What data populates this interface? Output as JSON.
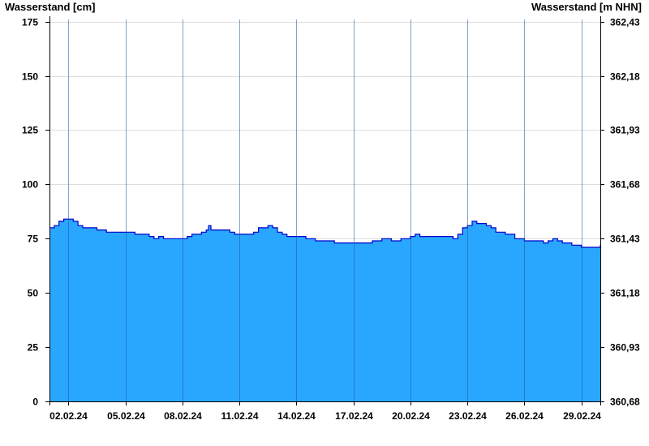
{
  "chart_data": {
    "type": "area",
    "ylabel_left": "Wasserstand [cm]",
    "ylabel_right": "Wasserstand [m NHN]",
    "ylim": [
      0,
      176
    ],
    "left_ticks": [
      0,
      25,
      50,
      75,
      100,
      125,
      150,
      175
    ],
    "right_ticks": [
      "360,68",
      "360,93",
      "361,18",
      "361,43",
      "361,68",
      "361,93",
      "362,18",
      "362,43"
    ],
    "x_start": "2024-02-01",
    "x_end": "2024-03-01",
    "x_tick_labels": [
      "02.02.24",
      "05.02.24",
      "08.02.24",
      "11.02.24",
      "14.02.24",
      "17.02.24",
      "20.02.24",
      "23.02.24",
      "26.02.24",
      "29.02.24"
    ],
    "x_tick_dates": [
      "2024-02-02",
      "2024-02-05",
      "2024-02-08",
      "2024-02-11",
      "2024-02-14",
      "2024-02-17",
      "2024-02-20",
      "2024-02-23",
      "2024-02-26",
      "2024-02-29"
    ],
    "grid": true,
    "colors": {
      "fill": "#29a7ff",
      "line": "#0000cc",
      "grid": "#dddddd",
      "day_lines": "#1a5a9a"
    },
    "series": [
      {
        "name": "",
        "points": [
          [
            "2024-02-01T00:00",
            80
          ],
          [
            "2024-02-01T06:00",
            81
          ],
          [
            "2024-02-01T12:00",
            83
          ],
          [
            "2024-02-01T18:00",
            84
          ],
          [
            "2024-02-02T00:00",
            84
          ],
          [
            "2024-02-02T06:00",
            83
          ],
          [
            "2024-02-02T12:00",
            81
          ],
          [
            "2024-02-02T18:00",
            80
          ],
          [
            "2024-02-03T00:00",
            80
          ],
          [
            "2024-02-03T12:00",
            79
          ],
          [
            "2024-02-04T00:00",
            78
          ],
          [
            "2024-02-04T12:00",
            78
          ],
          [
            "2024-02-05T00:00",
            78
          ],
          [
            "2024-02-05T12:00",
            77
          ],
          [
            "2024-02-06T00:00",
            77
          ],
          [
            "2024-02-06T06:00",
            76
          ],
          [
            "2024-02-06T12:00",
            75
          ],
          [
            "2024-02-06T18:00",
            76
          ],
          [
            "2024-02-07T00:00",
            75
          ],
          [
            "2024-02-07T12:00",
            75
          ],
          [
            "2024-02-08T00:00",
            75
          ],
          [
            "2024-02-08T06:00",
            76
          ],
          [
            "2024-02-08T12:00",
            77
          ],
          [
            "2024-02-08T18:00",
            77
          ],
          [
            "2024-02-09T00:00",
            78
          ],
          [
            "2024-02-09T06:00",
            79
          ],
          [
            "2024-02-09T09:00",
            81
          ],
          [
            "2024-02-09T12:00",
            79
          ],
          [
            "2024-02-10T00:00",
            79
          ],
          [
            "2024-02-10T12:00",
            78
          ],
          [
            "2024-02-10T18:00",
            77
          ],
          [
            "2024-02-11T00:00",
            77
          ],
          [
            "2024-02-11T12:00",
            77
          ],
          [
            "2024-02-11T18:00",
            78
          ],
          [
            "2024-02-12T00:00",
            80
          ],
          [
            "2024-02-12T12:00",
            81
          ],
          [
            "2024-02-12T18:00",
            80
          ],
          [
            "2024-02-13T00:00",
            78
          ],
          [
            "2024-02-13T06:00",
            77
          ],
          [
            "2024-02-13T12:00",
            76
          ],
          [
            "2024-02-14T00:00",
            76
          ],
          [
            "2024-02-14T12:00",
            75
          ],
          [
            "2024-02-15T00:00",
            74
          ],
          [
            "2024-02-15T12:00",
            74
          ],
          [
            "2024-02-16T00:00",
            73
          ],
          [
            "2024-02-16T12:00",
            73
          ],
          [
            "2024-02-17T00:00",
            73
          ],
          [
            "2024-02-17T12:00",
            73
          ],
          [
            "2024-02-18T00:00",
            74
          ],
          [
            "2024-02-18T12:00",
            75
          ],
          [
            "2024-02-19T00:00",
            74
          ],
          [
            "2024-02-19T12:00",
            75
          ],
          [
            "2024-02-20T00:00",
            76
          ],
          [
            "2024-02-20T06:00",
            77
          ],
          [
            "2024-02-20T12:00",
            76
          ],
          [
            "2024-02-21T00:00",
            76
          ],
          [
            "2024-02-21T12:00",
            76
          ],
          [
            "2024-02-22T00:00",
            76
          ],
          [
            "2024-02-22T06:00",
            75
          ],
          [
            "2024-02-22T12:00",
            77
          ],
          [
            "2024-02-22T18:00",
            80
          ],
          [
            "2024-02-23T00:00",
            81
          ],
          [
            "2024-02-23T06:00",
            83
          ],
          [
            "2024-02-23T12:00",
            82
          ],
          [
            "2024-02-23T18:00",
            82
          ],
          [
            "2024-02-24T00:00",
            81
          ],
          [
            "2024-02-24T06:00",
            80
          ],
          [
            "2024-02-24T12:00",
            78
          ],
          [
            "2024-02-25T00:00",
            77
          ],
          [
            "2024-02-25T12:00",
            75
          ],
          [
            "2024-02-26T00:00",
            74
          ],
          [
            "2024-02-26T12:00",
            74
          ],
          [
            "2024-02-27T00:00",
            73
          ],
          [
            "2024-02-27T06:00",
            74
          ],
          [
            "2024-02-27T12:00",
            75
          ],
          [
            "2024-02-27T18:00",
            74
          ],
          [
            "2024-02-28T00:00",
            73
          ],
          [
            "2024-02-28T12:00",
            72
          ],
          [
            "2024-02-29T00:00",
            71
          ],
          [
            "2024-02-29T12:00",
            71
          ],
          [
            "2024-02-29T18:00",
            71
          ],
          [
            "2024-03-01T00:00",
            72
          ]
        ]
      }
    ]
  }
}
